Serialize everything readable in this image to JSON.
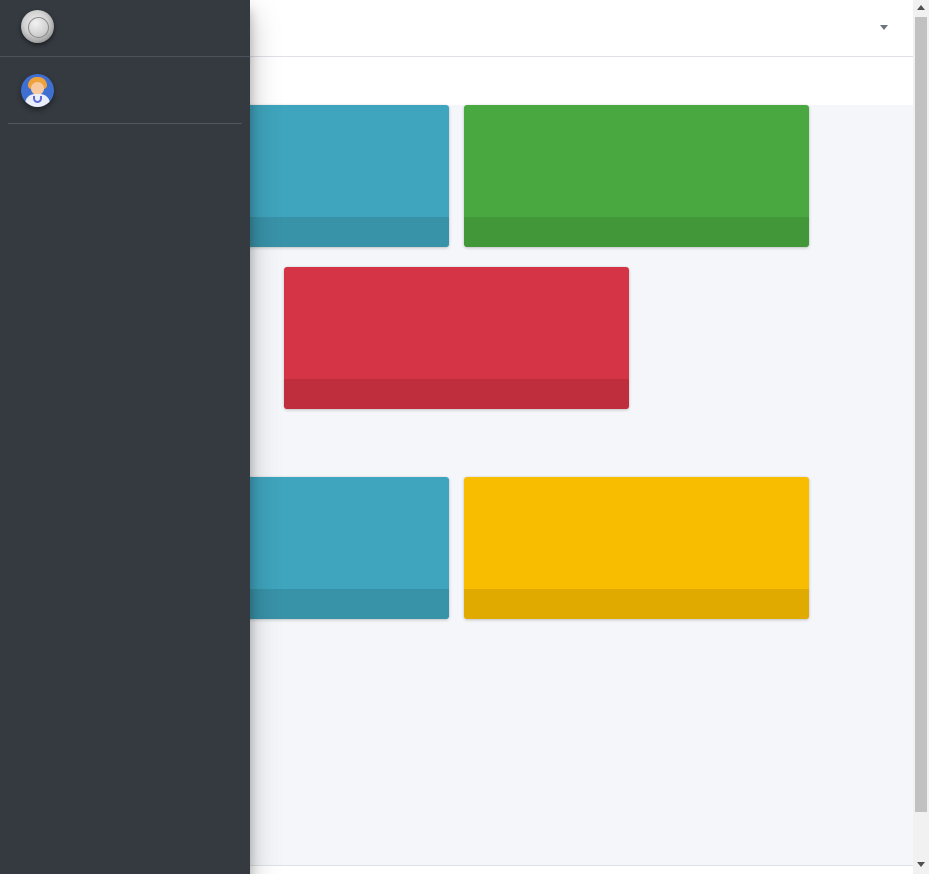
{
  "navbar": {
    "dropdown_icon": "caret-down-icon"
  },
  "sidebar": {
    "brand_logo_icon": "brand-seal-logo",
    "user_avatar_icon": "doctor-avatar"
  },
  "boxes": [
    {
      "id": "box-info-1",
      "color": "#3fa4bd",
      "footer_color": "#3892a8"
    },
    {
      "id": "box-success",
      "color": "#49a83f",
      "footer_color": "#429838"
    },
    {
      "id": "box-danger",
      "color": "#d43446",
      "footer_color": "#be2e3d"
    },
    {
      "id": "box-info-2",
      "color": "#3fa4bd",
      "footer_color": "#3892a8"
    },
    {
      "id": "box-warning",
      "color": "#f9bd00",
      "footer_color": "#e0aa00"
    }
  ],
  "colors": {
    "sidebar_bg": "#343a40",
    "content_bg": "#f4f6f9",
    "navbar_bg": "#ffffff"
  },
  "scrollbar": {
    "up_icon": "arrow-up-icon",
    "down_icon": "arrow-down-icon"
  }
}
